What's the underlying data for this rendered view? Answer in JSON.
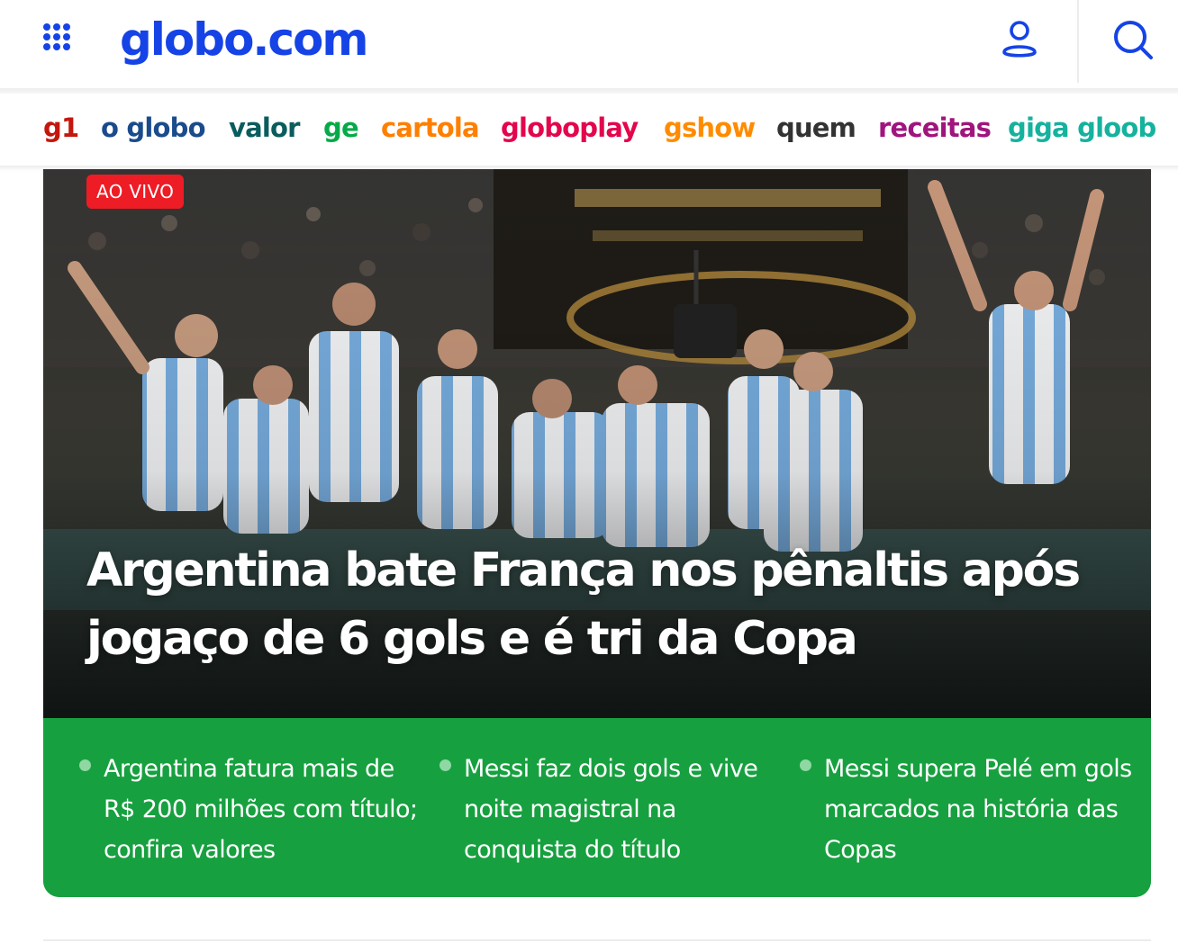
{
  "header": {
    "logo_text": "globo.com",
    "menu_icon": "grid-menu-icon",
    "user_icon": "user-icon",
    "search_icon": "search-icon",
    "brand_color": "#1543e6"
  },
  "brands": [
    {
      "label": "g1",
      "color": "#c4170c"
    },
    {
      "label": "o globo",
      "color": "#1a4b8c"
    },
    {
      "label": "valor",
      "color": "#0a5c5e"
    },
    {
      "label": "ge",
      "color": "#06aa48"
    },
    {
      "label": "cartola",
      "color": "#ff7f00"
    },
    {
      "label": "globoplay",
      "color": "#e3064d"
    },
    {
      "label": "gshow",
      "color": "#ff8c00"
    },
    {
      "label": "quem",
      "color": "#333333"
    },
    {
      "label": "receitas",
      "color": "#a0157d"
    },
    {
      "label": "giga gloob",
      "color": "#15b29e"
    }
  ],
  "hero": {
    "badge": "AO VIVO",
    "headline": "Argentina bate França nos pênaltis após jogaço de 6 gols e é tri da Copa",
    "related": [
      "Argentina fatura mais de R$ 200 milhões com título; confira valores",
      "Messi faz dois gols e vive noite magistral na conquista do título",
      "Messi supera Pelé em gols marcados na história das Copas"
    ],
    "accent_green": "#17a03f",
    "badge_red": "#ee1c25"
  }
}
